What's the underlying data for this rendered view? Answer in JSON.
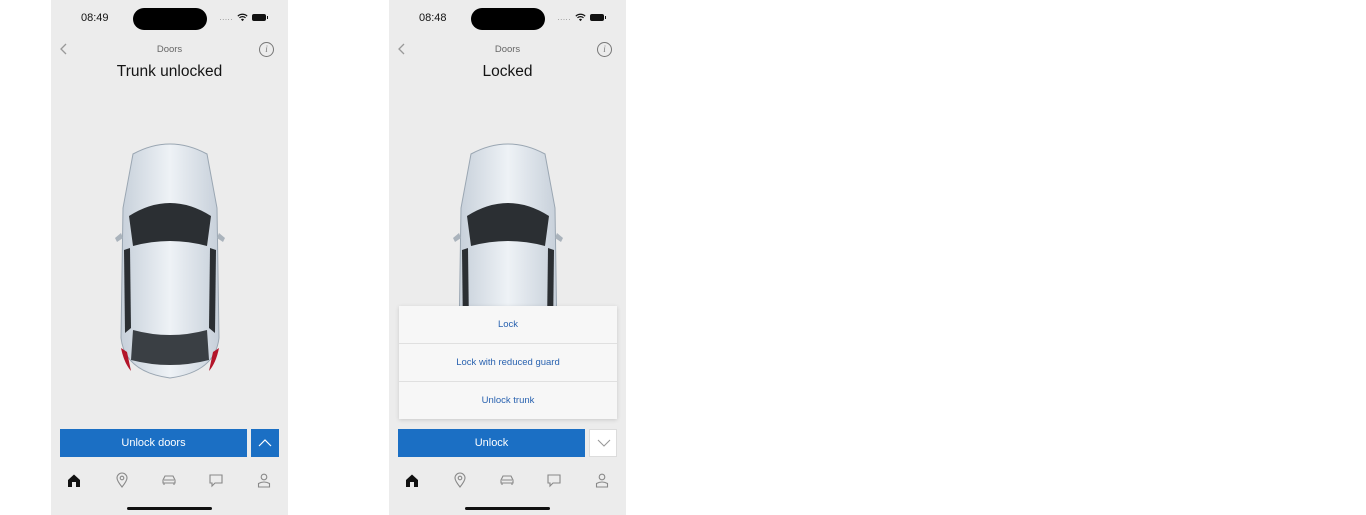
{
  "screens": [
    {
      "status_bar": {
        "time": "08:49",
        "signal": "....."
      },
      "header": {
        "title": "Doors"
      },
      "page_title": "Trunk unlocked",
      "primary_button": "Unlock doors",
      "toggle_state": "expanded",
      "menu_items": [],
      "active_tab": "home"
    },
    {
      "status_bar": {
        "time": "08:48",
        "signal": "....."
      },
      "header": {
        "title": "Doors"
      },
      "page_title": "Locked",
      "primary_button": "Unlock",
      "toggle_state": "collapsed",
      "menu_items": [
        "Lock",
        "Lock with reduced guard",
        "Unlock trunk"
      ],
      "active_tab": "home"
    }
  ],
  "tabs": [
    "home-icon",
    "location-pin-icon",
    "car-icon",
    "chat-icon",
    "profile-icon"
  ],
  "colors": {
    "accent": "#1b6fc4",
    "menu_text": "#2a63b0",
    "background": "#ececec"
  }
}
